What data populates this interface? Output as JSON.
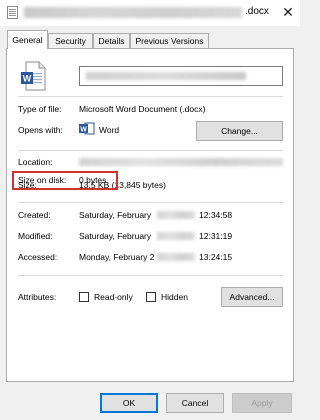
{
  "window": {
    "title_suffix": ".docx",
    "close_glyph": "✕",
    "icon": "document-icon"
  },
  "tabs": [
    {
      "label": "General",
      "active": true
    },
    {
      "label": "Security",
      "active": false
    },
    {
      "label": "Details",
      "active": false
    },
    {
      "label": "Previous Versions",
      "active": false
    }
  ],
  "general": {
    "file_icon": "word-document-icon",
    "type_label": "Type of file:",
    "type_value": "Microsoft Word Document (.docx)",
    "opens_label": "Opens with:",
    "opens_app": "Word",
    "opens_app_icon": "word-app-icon",
    "change_button": "Change...",
    "location_label": "Location:",
    "size_label": "Size:",
    "size_value": "13.5 KB (13,845 bytes)",
    "size_on_disk_label": "Size on disk:",
    "size_on_disk_value": "0 bytes",
    "created_label": "Created:",
    "created_value_start": "Saturday, February",
    "created_time": "12:34:58",
    "modified_label": "Modified:",
    "modified_value_start": "Saturday, February",
    "modified_time": "12:31:19",
    "accessed_label": "Accessed:",
    "accessed_value_start": "Monday, February 2",
    "accessed_time": "13:24:15",
    "attributes_label": "Attributes:",
    "readonly_label": "Read-only",
    "hidden_label": "Hidden",
    "advanced_button": "Advanced..."
  },
  "footer": {
    "ok": "OK",
    "cancel": "Cancel",
    "apply": "Apply"
  },
  "colors": {
    "highlight": "#d0312d",
    "word_blue": "#2b579a",
    "focus_blue": "#0078d7"
  }
}
